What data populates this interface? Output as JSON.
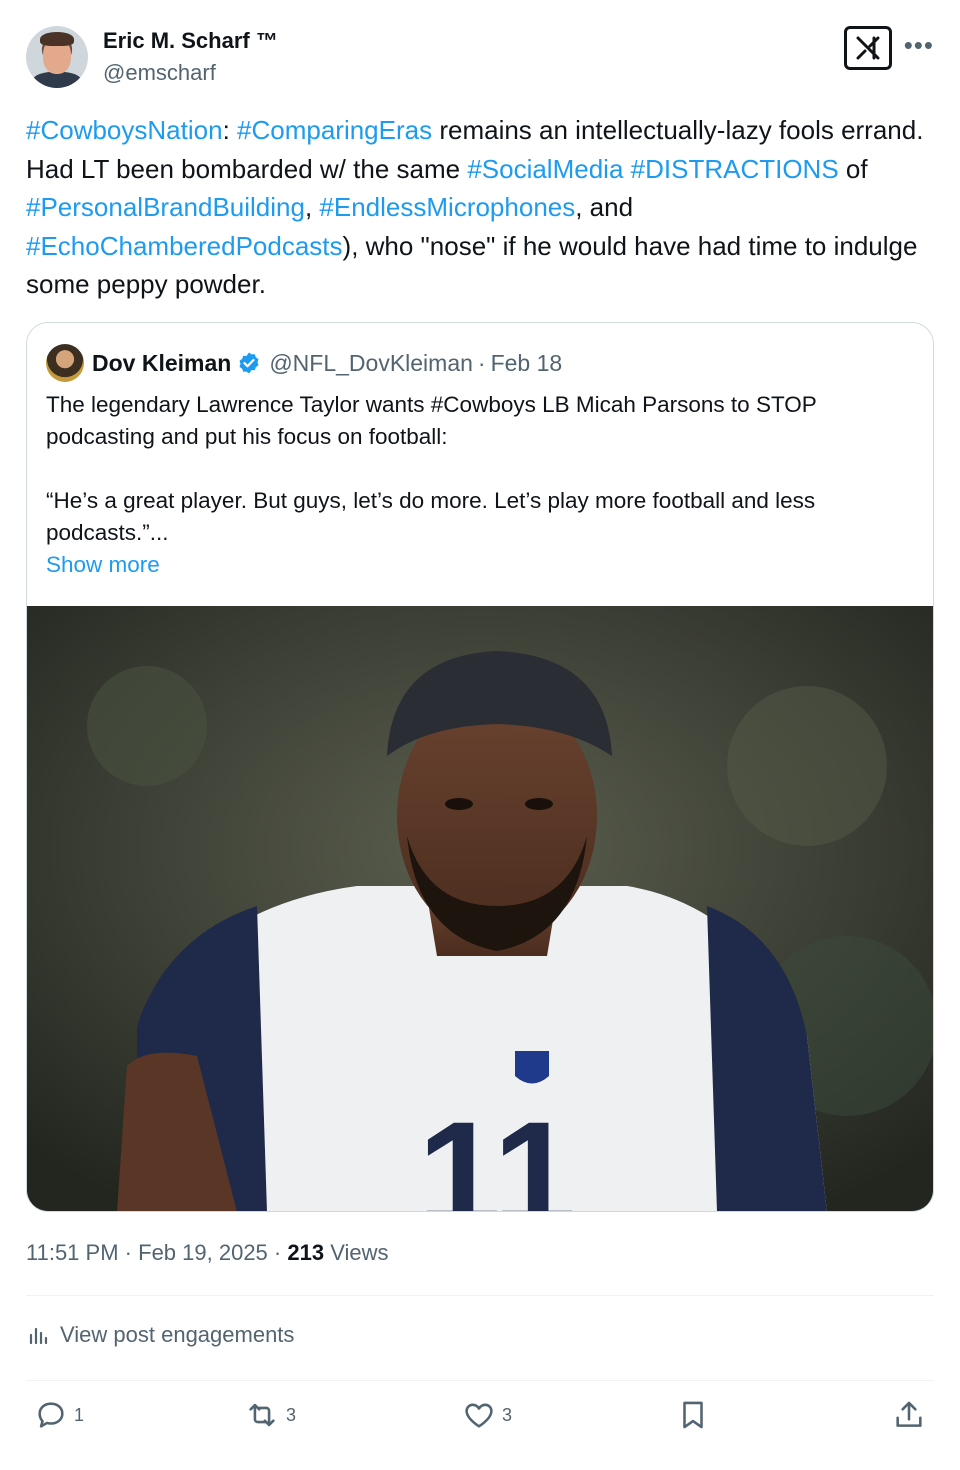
{
  "author": {
    "name": "Eric M. Scharf ™",
    "handle": "@emscharf"
  },
  "icons": {
    "grok": "grok-icon",
    "more": "more-icon",
    "verified": "verified-badge-icon",
    "analytics": "analytics-icon",
    "reply": "reply-icon",
    "repost": "repost-icon",
    "like": "like-icon",
    "bookmark": "bookmark-icon",
    "share": "share-icon"
  },
  "tweet": {
    "segments": [
      {
        "text": "#CowboysNation",
        "hashtag": true
      },
      {
        "text": ": ",
        "hashtag": false
      },
      {
        "text": "#ComparingEras",
        "hashtag": true
      },
      {
        "text": " remains an intellectually-lazy fools errand. Had LT been bombarded w/ the same ",
        "hashtag": false
      },
      {
        "text": "#SocialMedia",
        "hashtag": true
      },
      {
        "text": " ",
        "hashtag": false
      },
      {
        "text": "#DISTRACTIONS",
        "hashtag": true
      },
      {
        "text": " of ",
        "hashtag": false
      },
      {
        "text": "#PersonalBrandBuilding",
        "hashtag": true
      },
      {
        "text": ", ",
        "hashtag": false
      },
      {
        "text": "#EndlessMicrophones",
        "hashtag": true
      },
      {
        "text": ", and ",
        "hashtag": false
      },
      {
        "text": "#EchoChamberedPodcasts",
        "hashtag": true
      },
      {
        "text": "), who \"nose\" if he would have had time to indulge some peppy powder.",
        "hashtag": false
      }
    ]
  },
  "quote": {
    "name": "Dov Kleiman",
    "handle": "@NFL_DovKleiman",
    "date": "Feb 18",
    "separator": "·",
    "line1": "The legendary Lawrence Taylor wants #Cowboys LB Micah Parsons to STOP podcasting and put his focus on football:",
    "line2": "“He’s a great player. But guys, let’s do more. Let’s play more football and less podcasts.”...",
    "show_more": "Show more",
    "image_jersey_number": "11"
  },
  "meta": {
    "time": "11:51 PM",
    "date": "Feb 19, 2025",
    "separator": "·",
    "views_count": "213",
    "views_label": "Views"
  },
  "engagements_label": "View post engagements",
  "actions": {
    "replies": "1",
    "reposts": "3",
    "likes": "3"
  }
}
